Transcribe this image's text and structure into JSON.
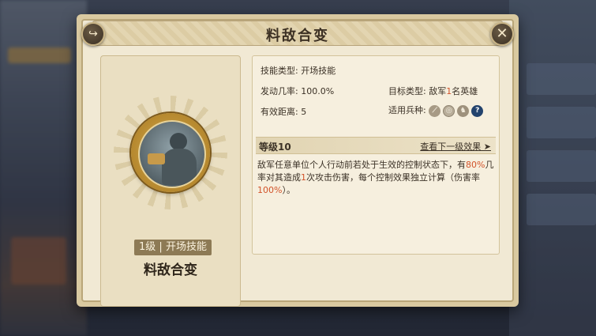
{
  "dialog": {
    "title": "料敌合变",
    "share_icon": "share-icon",
    "close_icon": "close-icon",
    "close_symbol": "✕"
  },
  "skill": {
    "tag_level": "1级",
    "tag_sep": "|",
    "tag_type": "开场技能",
    "name": "料敌合变"
  },
  "info": {
    "skill_type_label": "技能类型:",
    "skill_type_value": "开场技能",
    "trigger_rate_label": "发动几率:",
    "trigger_rate_value": "100.0%",
    "target_label": "目标类型:",
    "target_prefix": "敌军",
    "target_count": "1",
    "target_suffix": "名英雄",
    "range_label": "有效距离:",
    "range_value": "5",
    "troops_label": "适用兵种:",
    "troops": [
      {
        "icon": "spear-troop-icon",
        "glyph": "⟋"
      },
      {
        "icon": "shield-troop-icon",
        "glyph": "◎"
      },
      {
        "icon": "cavalry-troop-icon",
        "glyph": "♞"
      },
      {
        "icon": "unknown-troop-icon",
        "glyph": "?"
      }
    ]
  },
  "level": {
    "label": "等级10",
    "next_link": "查看下一级效果 ➤"
  },
  "description": {
    "part1": "敌军任意单位个人行动前若处于生效的控制状态下，有",
    "rate": "80%",
    "part2": "几率对其造成",
    "hits": "1",
    "part3": "次攻击伤害，每个控制效果独立计算（伤害率",
    "damage": "100%",
    "part4": "）。"
  },
  "colors": {
    "highlight": "#d2532a",
    "panel_bg": "#f1e9d4",
    "text": "#3b3126"
  }
}
